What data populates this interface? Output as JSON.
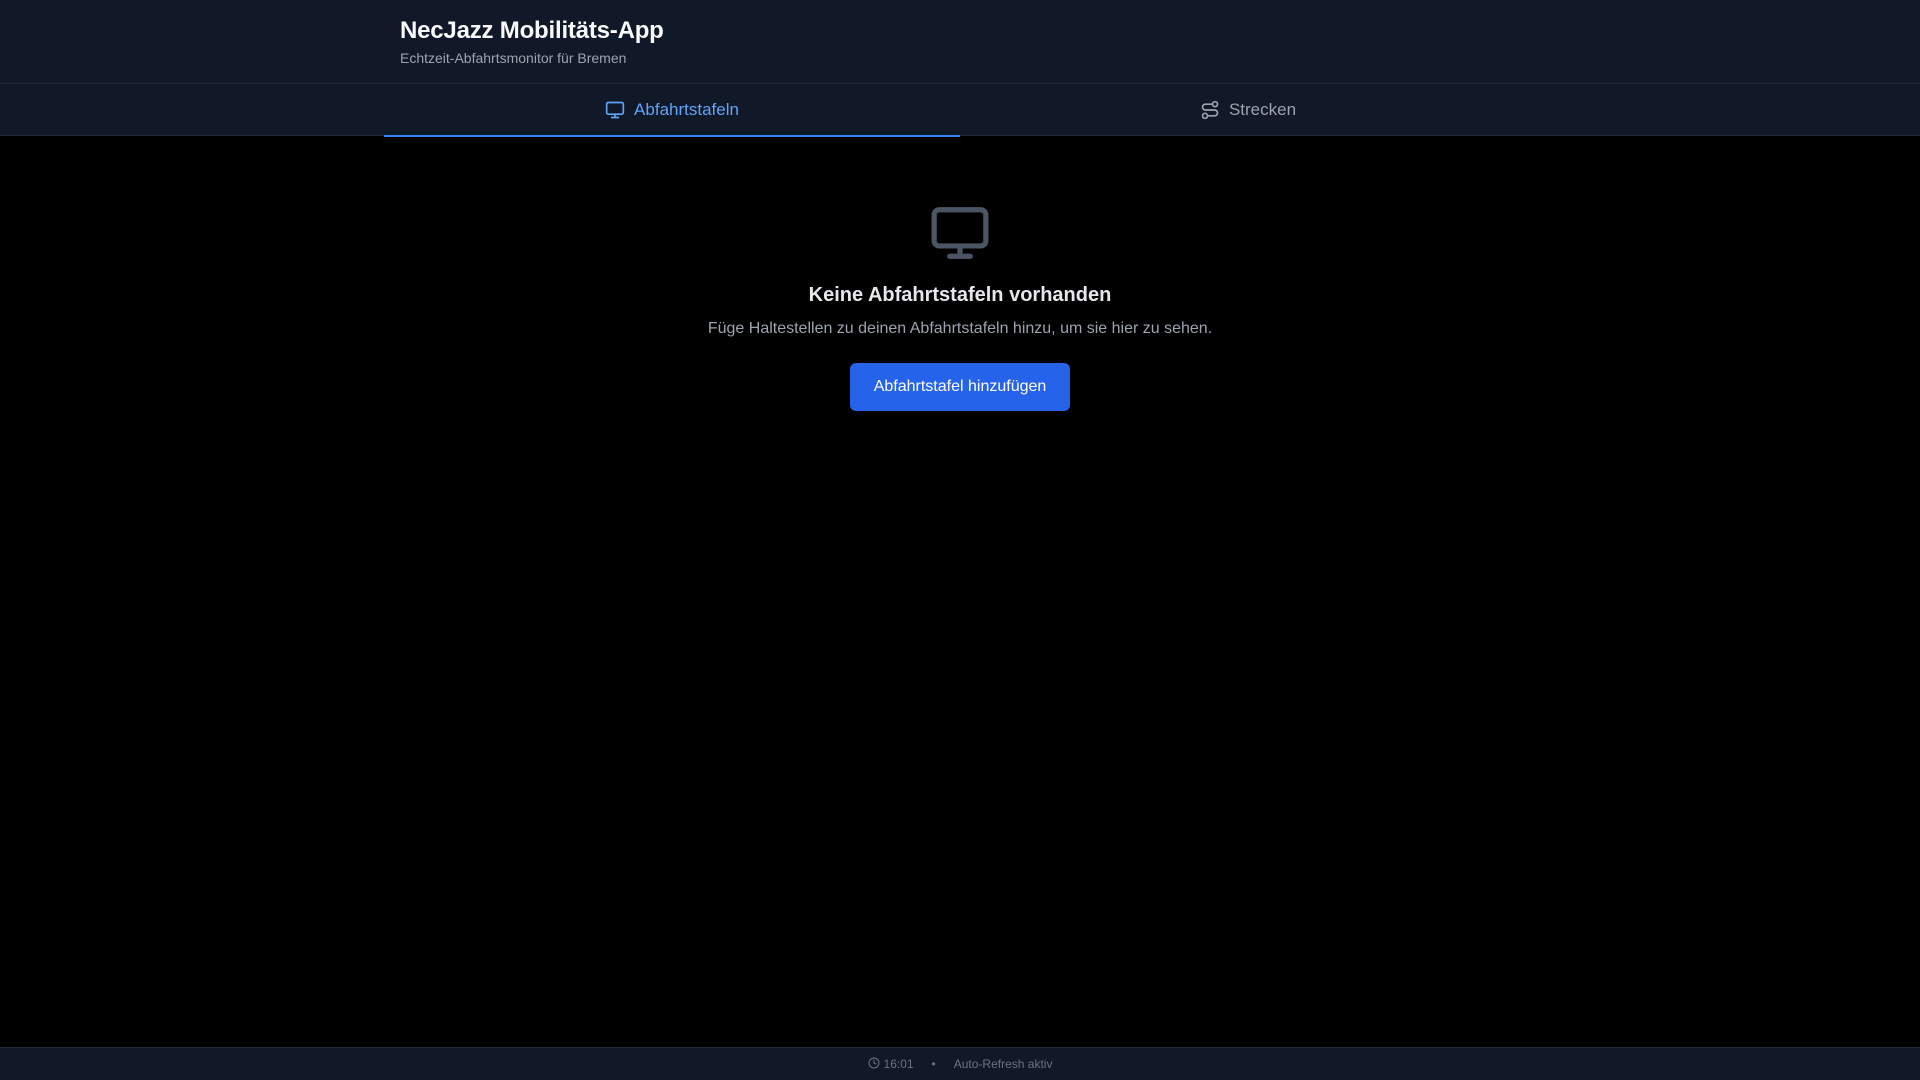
{
  "header": {
    "title": "NecJazz Mobilitäts-App",
    "subtitle": "Echtzeit-Abfahrtsmonitor für Bremen"
  },
  "tabs": [
    {
      "label": "Abfahrtstafeln",
      "icon": "monitor-icon",
      "active": true
    },
    {
      "label": "Strecken",
      "icon": "route-icon",
      "active": false
    }
  ],
  "empty_state": {
    "icon": "monitor-icon",
    "title": "Keine Abfahrtstafeln vorhanden",
    "text": "Füge Haltestellen zu deinen Abfahrtstafeln hinzu, um sie hier zu sehen.",
    "button_label": "Abfahrtstafel hinzufügen"
  },
  "footer": {
    "time": "16:01",
    "separator": "•",
    "status": "Auto-Refresh aktiv"
  },
  "colors": {
    "accent": "#3b82f6",
    "button": "#2563eb",
    "header_bg": "#111827",
    "page_bg": "#000000"
  }
}
